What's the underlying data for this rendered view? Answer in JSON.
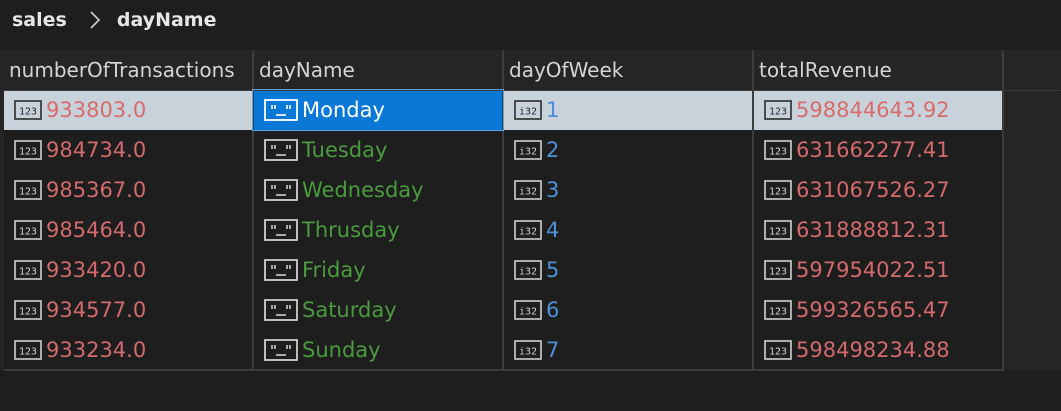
{
  "breadcrumb": {
    "items": [
      "sales",
      "dayName"
    ]
  },
  "colors": {
    "background": "#1e1e1e",
    "grid_header": "#252526",
    "number": "#d2696a",
    "integer": "#4f91d8",
    "string": "#4a9b3d",
    "selected_row": "#c7d2db",
    "active_cell": "#0a78d7"
  },
  "table": {
    "columns": [
      {
        "label": "numberOfTransactions",
        "type_icon": "decimal-type-icon"
      },
      {
        "label": "dayName",
        "type_icon": "string-type-icon"
      },
      {
        "label": "dayOfWeek",
        "type_icon": "integer-type-icon"
      },
      {
        "label": "totalRevenue",
        "type_icon": "decimal-type-icon"
      }
    ],
    "rows": [
      {
        "numberOfTransactions": "933803.0",
        "dayName": "Monday",
        "dayOfWeek": "1",
        "totalRevenue": "598844643.92"
      },
      {
        "numberOfTransactions": "984734.0",
        "dayName": "Tuesday",
        "dayOfWeek": "2",
        "totalRevenue": "631662277.41"
      },
      {
        "numberOfTransactions": "985367.0",
        "dayName": "Wednesday",
        "dayOfWeek": "3",
        "totalRevenue": "631067526.27"
      },
      {
        "numberOfTransactions": "985464.0",
        "dayName": "Thrusday",
        "dayOfWeek": "4",
        "totalRevenue": "631888812.31"
      },
      {
        "numberOfTransactions": "933420.0",
        "dayName": "Friday",
        "dayOfWeek": "5",
        "totalRevenue": "597954022.51"
      },
      {
        "numberOfTransactions": "934577.0",
        "dayName": "Saturday",
        "dayOfWeek": "6",
        "totalRevenue": "599326565.47"
      },
      {
        "numberOfTransactions": "933234.0",
        "dayName": "Sunday",
        "dayOfWeek": "7",
        "totalRevenue": "598498234.88"
      }
    ],
    "selected_row": 0,
    "active_column": "dayName"
  }
}
